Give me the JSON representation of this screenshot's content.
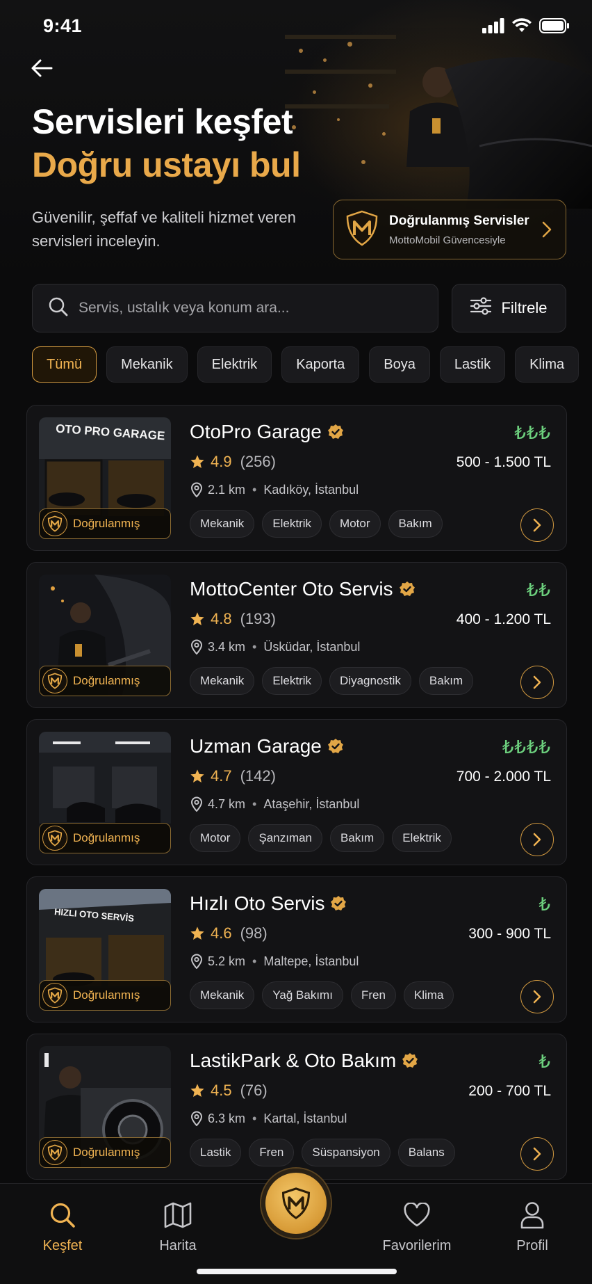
{
  "status_bar": {
    "time": "9:41"
  },
  "hero": {
    "title": "Servisleri keşfet",
    "subtitle": "Doğru ustayı bul",
    "description": "Güvenilir, şeffaf ve kaliteli hizmet veren servisleri inceleyin.",
    "verified_card": {
      "title": "Doğrulanmış Servisler",
      "subtitle": "MottoMobil Güvencesiyle"
    },
    "accent_color": "#e9a94a"
  },
  "search": {
    "placeholder": "Servis, ustalık veya konum ara...",
    "value": ""
  },
  "filter": {
    "label": "Filtrele"
  },
  "categories": [
    "Tümü",
    "Mekanik",
    "Elektrik",
    "Kaporta",
    "Boya",
    "Lastik",
    "Klima"
  ],
  "selected_category": "Tümü",
  "verified_badge_label": "Doğrulanmış",
  "services": [
    {
      "name": "OtoPro Garage",
      "rating": "4.9",
      "reviews": "(256)",
      "distance": "2.1 km",
      "location": "Kadıköy, İstanbul",
      "price_level": "₺₺₺",
      "price_range": "500 - 1.500 TL",
      "tags": [
        "Mekanik",
        "Elektrik",
        "Motor",
        "Bakım"
      ],
      "image_sign": "OTO PRO GARAGE"
    },
    {
      "name": "MottoCenter Oto Servis",
      "rating": "4.8",
      "reviews": "(193)",
      "distance": "3.4 km",
      "location": "Üsküdar, İstanbul",
      "price_level": "₺₺",
      "price_range": "400 - 1.200 TL",
      "tags": [
        "Mekanik",
        "Elektrik",
        "Diyagnostik",
        "Bakım"
      ],
      "image_sign": ""
    },
    {
      "name": "Uzman Garage",
      "rating": "4.7",
      "reviews": "(142)",
      "distance": "4.7 km",
      "location": "Ataşehir, İstanbul",
      "price_level": "₺₺₺₺",
      "price_range": "700 - 2.000 TL",
      "tags": [
        "Motor",
        "Şanzıman",
        "Bakım",
        "Elektrik"
      ],
      "image_sign": ""
    },
    {
      "name": "Hızlı Oto Servis",
      "rating": "4.6",
      "reviews": "(98)",
      "distance": "5.2 km",
      "location": "Maltepe, İstanbul",
      "price_level": "₺",
      "price_range": "300 - 900 TL",
      "tags": [
        "Mekanik",
        "Yağ Bakımı",
        "Fren",
        "Klima"
      ],
      "image_sign": "HIZLI OTO SERVİS"
    },
    {
      "name": "LastikPark & Oto Bakım",
      "rating": "4.5",
      "reviews": "(76)",
      "distance": "6.3 km",
      "location": "Kartal, İstanbul",
      "price_level": "₺",
      "price_range": "200 - 700 TL",
      "tags": [
        "Lastik",
        "Fren",
        "Süspansiyon",
        "Balans"
      ],
      "image_sign": ""
    }
  ],
  "bottom_nav": {
    "items": [
      {
        "label": "Keşfet",
        "icon": "search-icon",
        "active": true
      },
      {
        "label": "Harita",
        "icon": "map-icon",
        "active": false
      },
      {
        "label": "",
        "icon": "motto-logo-icon",
        "active": false
      },
      {
        "label": "Favorilerim",
        "icon": "heart-icon",
        "active": false
      },
      {
        "label": "Profil",
        "icon": "user-icon",
        "active": false
      }
    ]
  },
  "colors": {
    "gold": "#f0b352",
    "price_green": "#6ccf7d",
    "background": "#0b0b0c",
    "card": "#131315"
  }
}
